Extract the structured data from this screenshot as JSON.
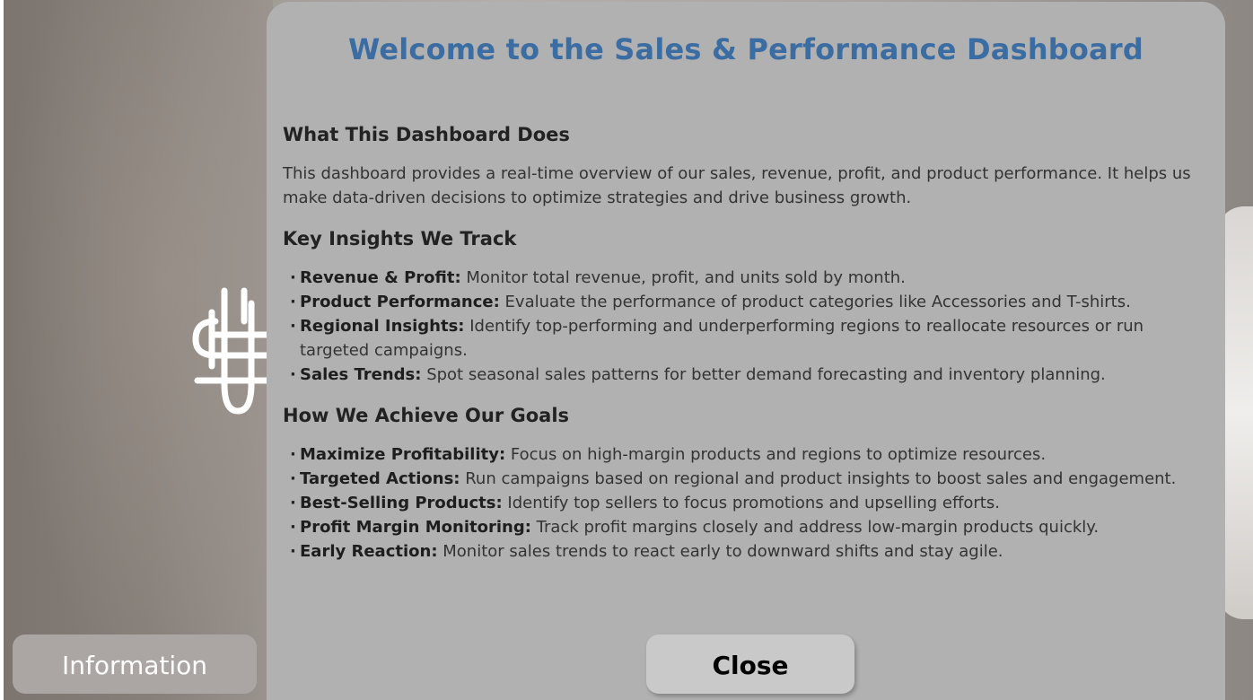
{
  "panel": {
    "title": "Welcome to the Sales & Performance Dashboard",
    "sections": {
      "what": {
        "heading": "What This Dashboard Does",
        "text": "This dashboard provides a real-time overview of our sales, revenue, profit, and product performance. It helps us make data-driven decisions to optimize strategies and drive business growth."
      },
      "insights": {
        "heading": "Key Insights We Track",
        "items": [
          {
            "label": "Revenue & Profit:",
            "text": " Monitor total revenue, profit, and units sold by month."
          },
          {
            "label": "Product Performance:",
            "text": " Evaluate the performance of product categories like Accessories and T-shirts."
          },
          {
            "label": "Regional Insights:",
            "text": " Identify top-performing and underperforming regions to reallocate resources or run targeted campaigns."
          },
          {
            "label": "Sales Trends:",
            "text": " Spot seasonal sales patterns for better demand forecasting and inventory planning."
          }
        ]
      },
      "goals": {
        "heading": "How We Achieve Our Goals",
        "items": [
          {
            "label": "Maximize Profitability:",
            "text": " Focus on high-margin products and regions to optimize resources."
          },
          {
            "label": "Targeted Actions:",
            "text": " Run campaigns based on regional and product insights to boost sales and engagement."
          },
          {
            "label": "Best-Selling Products:",
            "text": " Identify top sellers to focus promotions and upselling efforts."
          },
          {
            "label": "Profit Margin Monitoring:",
            "text": " Track profit margins closely and address low-margin products quickly."
          },
          {
            "label": "Early Reaction:",
            "text": " Monitor sales trends to react early to downward shifts and stay agile."
          }
        ]
      }
    },
    "close_label": "Close"
  },
  "information_label": "Information",
  "colors": {
    "title": "#3b6da3",
    "panel_bg": "#b1b1b1",
    "close_button_bg": "#c9c9c9",
    "info_button_bg": "#aba6a3"
  },
  "icons": {
    "background_logo": "hashtag-logo-icon"
  }
}
